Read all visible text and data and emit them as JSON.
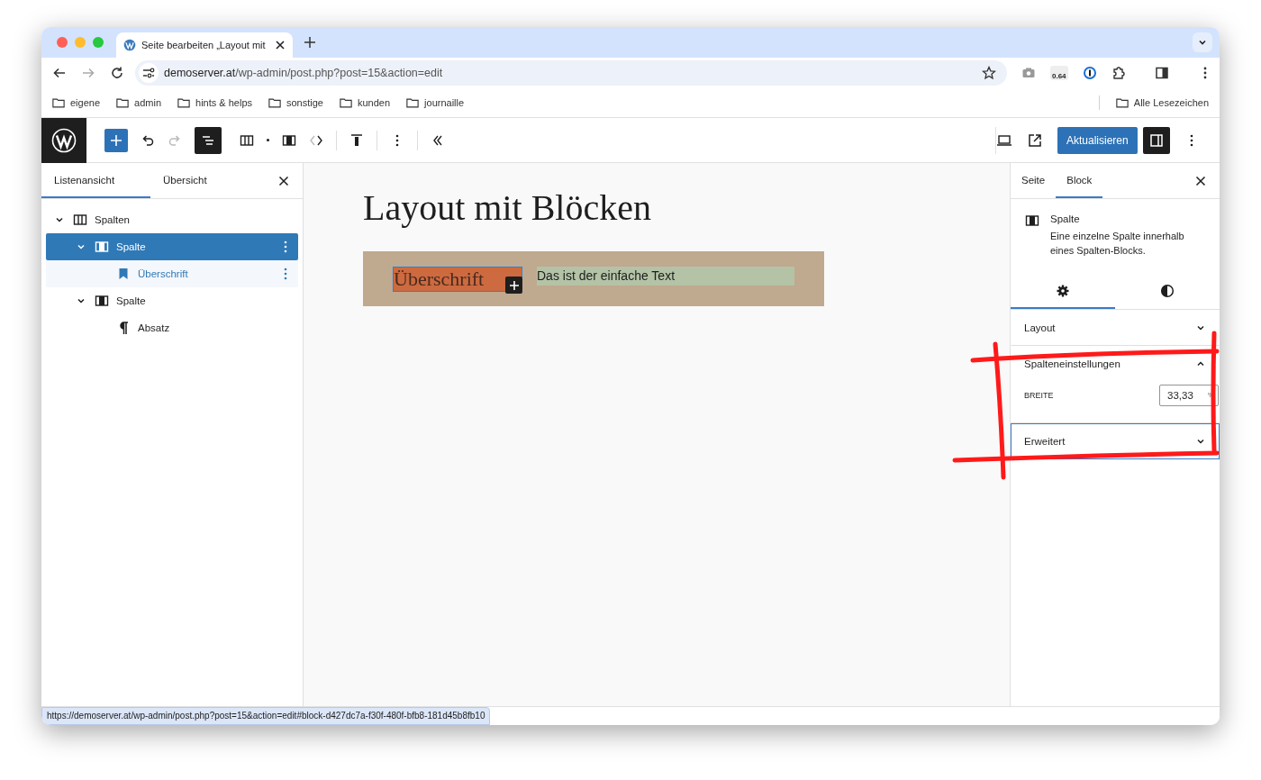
{
  "browser": {
    "tab": {
      "title": "Seite bearbeiten „Layout mit"
    },
    "address": {
      "host": "demoserver.at",
      "path": "/wp-admin/post.php?post=15&action=edit"
    },
    "extension_badge": "0.64",
    "bookmarks": [
      "eigene",
      "admin",
      "hints & helps",
      "sonstige",
      "kunden",
      "journaille"
    ],
    "all_bookmarks": "Alle Lesezeichen"
  },
  "editor_toolbar": {
    "update_button": "Aktualisieren"
  },
  "left_panel": {
    "tabs": [
      {
        "label": "Listenansicht",
        "selected": true
      },
      {
        "label": "Übersicht",
        "selected": false
      }
    ],
    "tree": [
      {
        "label": "Spalten",
        "kind": "columns",
        "selected": false,
        "expanded": true,
        "children": [
          {
            "label": "Spalte",
            "kind": "column",
            "selected": true,
            "expanded": true,
            "children": [
              {
                "label": "Überschrift",
                "kind": "heading",
                "selected": false
              }
            ]
          },
          {
            "label": "Spalte",
            "kind": "column",
            "selected": false,
            "expanded": true,
            "children": [
              {
                "label": "Absatz",
                "kind": "paragraph",
                "selected": false
              }
            ]
          }
        ]
      }
    ]
  },
  "canvas": {
    "title": "Layout mit Blöcken",
    "heading_block": "Überschrift",
    "paragraph_block": "Das ist der einfache Text"
  },
  "right_panel": {
    "tabs": [
      {
        "label": "Seite",
        "selected": false
      },
      {
        "label": "Block",
        "selected": true
      }
    ],
    "block": {
      "name": "Spalte",
      "description": "Eine einzelne Spalte innerhalb eines Spalten-Blocks."
    },
    "sub_tabs": [
      {
        "kind": "settings",
        "selected": true
      },
      {
        "kind": "styles",
        "selected": false
      }
    ],
    "sections": [
      {
        "title": "Layout",
        "expanded": false,
        "focused": false
      },
      {
        "title": "Spalteneinstellungen",
        "expanded": true,
        "focused": false,
        "field": {
          "label": "BREITE",
          "value": "33,33",
          "unit": "%"
        }
      },
      {
        "title": "Erweitert",
        "expanded": false,
        "focused": true
      }
    ]
  },
  "status_url": "https://demoserver.at/wp-admin/post.php?post=15&action=edit#block-d427dc7a-f30f-480f-bfb8-181d45b8fb10"
}
